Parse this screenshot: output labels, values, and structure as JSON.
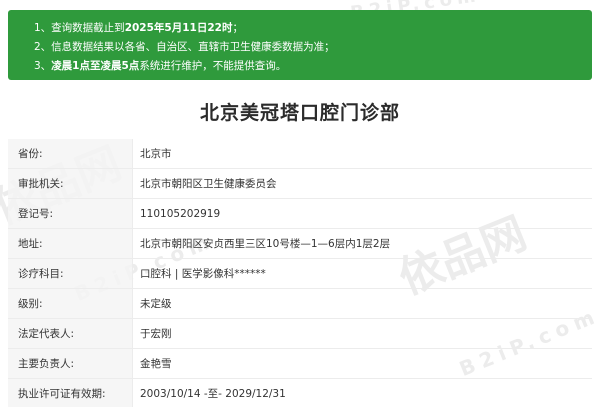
{
  "notice": {
    "line1": {
      "prefix": "1、查询数据截止到",
      "bold": "2025年5月11日22时",
      "suffix": "；"
    },
    "line2": "2、信息数据结果以各省、自治区、直辖市卫生健康委数据为准；",
    "line3": {
      "prefix": "3、",
      "bold": "凌晨1点至凌晨5点",
      "suffix": "系统进行维护，不能提供查询。"
    }
  },
  "watermark": {
    "brand": "依品网",
    "url": "B2iP.com"
  },
  "title": "北京美冠塔口腔门诊部",
  "rows": [
    {
      "label": "省份:",
      "value": "北京市"
    },
    {
      "label": "审批机关:",
      "value": "北京市朝阳区卫生健康委员会"
    },
    {
      "label": "登记号:",
      "value": "110105202919"
    },
    {
      "label": "地址:",
      "value": "北京市朝阳区安贞西里三区10号楼—1—6层内1层2层"
    },
    {
      "label": "诊疗科目:",
      "value": "口腔科 | 医学影像科******"
    },
    {
      "label": "级别:",
      "value": "未定级"
    },
    {
      "label": "法定代表人:",
      "value": "于宏刚"
    },
    {
      "label": "主要负责人:",
      "value": "金艳雪"
    },
    {
      "label": "执业许可证有效期:",
      "value": "2003/10/14 -至- 2029/12/31"
    }
  ]
}
